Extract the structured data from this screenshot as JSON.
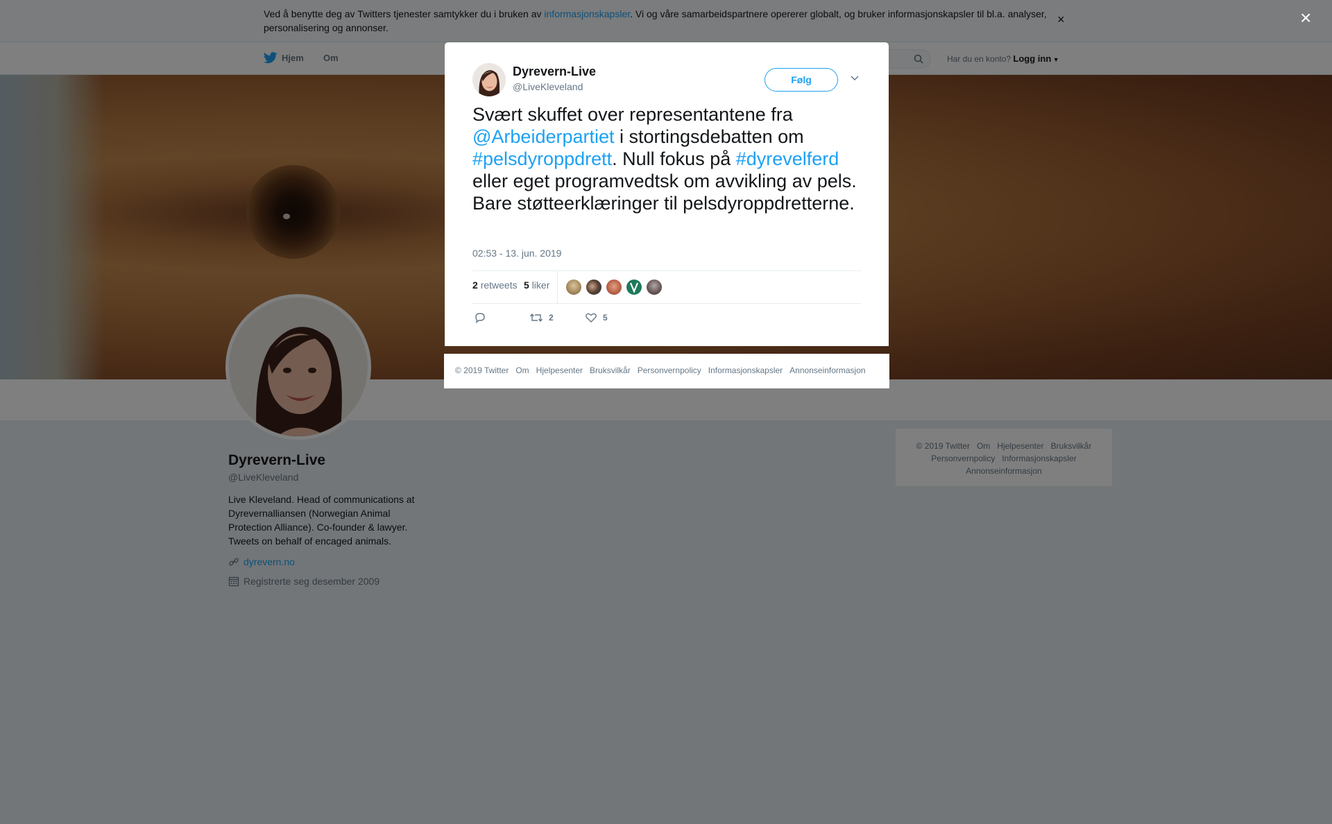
{
  "cookie_bar": {
    "text_before": "Ved å benytte deg av Twitters tjenester samtykker du i bruken av ",
    "link": "informasjonskapsler",
    "text_after": ". Vi og våre samarbeidspartnere opererer globalt, og bruker informasjonskapsler til bl.a. analyser, personalisering og annonser.",
    "close": "×"
  },
  "nav": {
    "home": "Hjem",
    "about": "Om",
    "have_account": "Har du en konto?",
    "login": "Logg inn"
  },
  "profile": {
    "name": "Dyrevern-Live",
    "handle": "@LiveKleveland",
    "bio": "Live Kleveland. Head of communications at Dyrevernalliansen (Norwegian Animal Protection Alliance). Co-founder & lawyer. Tweets on behalf of encaged animals.",
    "website": "dyrevern.no",
    "joined": "Registrerte seg desember 2009"
  },
  "side_footer": {
    "items": [
      "© 2019 Twitter",
      "Om",
      "Hjelpesenter",
      "Bruksvilkår",
      "Personvernpolicy",
      "Informasjonskapsler",
      "Annonseinformasjon"
    ]
  },
  "overlay_close": "×",
  "tweet": {
    "name": "Dyrevern-Live",
    "handle": "@LiveKleveland",
    "follow": "Følg",
    "text_1": "Svært skuffet over representantene fra ",
    "mention": "@Arbeiderpartiet",
    "text_2": " i stortingsdebatten om ",
    "hashtag_1": "#pelsdyroppdrett",
    "text_3": ". Null fokus på ",
    "hashtag_2": "#dyrevelferd",
    "text_4": " eller eget programvedtsk om avvikling av pels. Bare støtteerklæringer til pelsdyroppdretterne.",
    "timestamp": "02:53 - 13. jun. 2019",
    "retweets_count": "2",
    "retweets_label": "retweets",
    "likes_count": "5",
    "likes_label": "liker",
    "action_retweet_count": "2",
    "action_like_count": "5"
  },
  "modal_footer": {
    "items": [
      "© 2019 Twitter",
      "Om",
      "Hjelpesenter",
      "Bruksvilkår",
      "Personvernpolicy",
      "Informasjonskapsler",
      "Annonseinformasjon"
    ]
  },
  "colors": {
    "accent": "#1da1f2",
    "text": "#14171a",
    "secondary": "#657786",
    "page_bg": "#e6ecf0"
  }
}
